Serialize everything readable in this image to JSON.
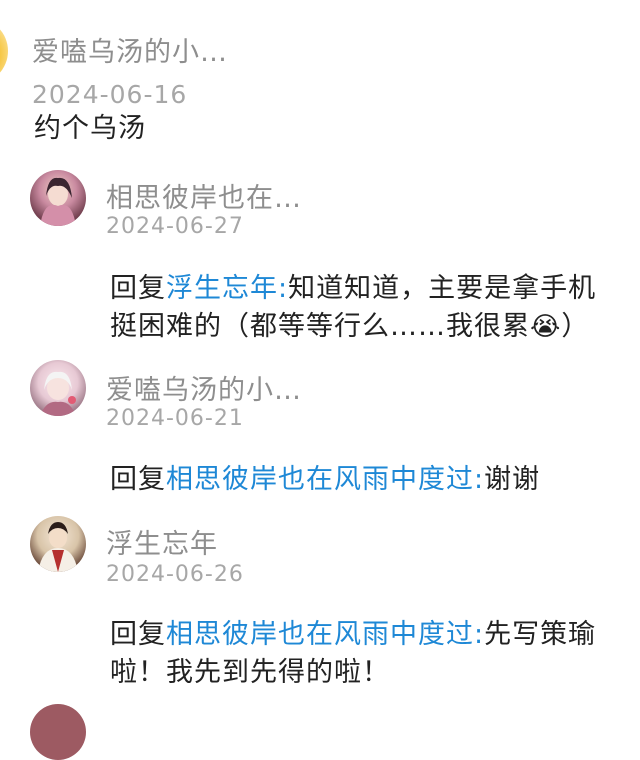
{
  "top_comment": {
    "username": "爱嗑乌汤的小…",
    "date": "2024-06-16",
    "text": "约个乌汤"
  },
  "replies": [
    {
      "username": "相思彼岸也在…",
      "date": "2024-06-27",
      "reply_prefix": "回复",
      "mention": "浮生忘年:",
      "text_line1": "知道知道，主要是拿手机",
      "text_line2": "挺困难的（都等等行么……我很累",
      "text_line2_end": "）",
      "emoji": "😭"
    },
    {
      "username": "爱嗑乌汤的小…",
      "date": "2024-06-21",
      "reply_prefix": "回复",
      "mention": "相思彼岸也在风雨中度过:",
      "text_line1": "谢谢"
    },
    {
      "username": "浮生忘年",
      "date": "2024-06-26",
      "reply_prefix": "回复",
      "mention": "相思彼岸也在风雨中度过:",
      "text_line1": "先写策瑜",
      "text_line2": "啦！我先到先得的啦！"
    }
  ]
}
